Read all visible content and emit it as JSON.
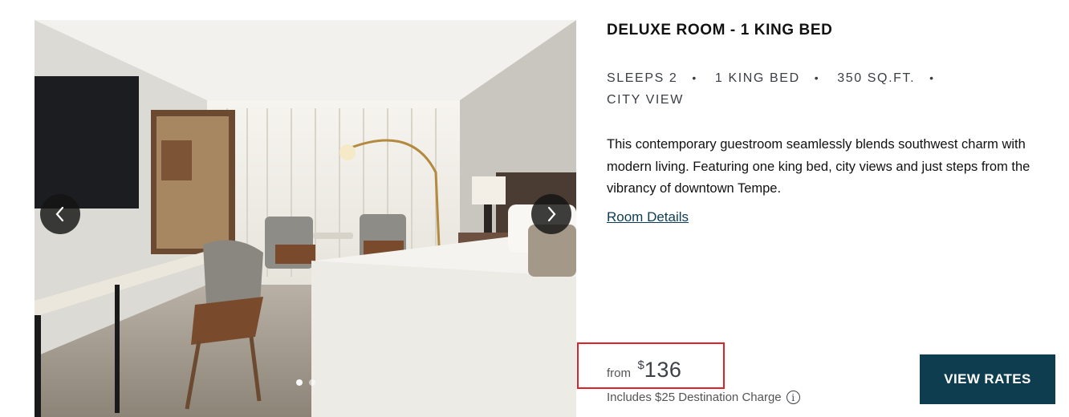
{
  "carousel": {
    "image_alt": "Deluxe room with king bed, desk, armchairs and city view",
    "prev_icon": "chevron-left-icon",
    "next_icon": "chevron-right-icon",
    "slide_count": 2,
    "active_slide": 1
  },
  "room": {
    "title": "DELUXE ROOM - 1 KING BED",
    "features": [
      "SLEEPS 2",
      "1 KING BED",
      "350 SQ.FT.",
      "CITY VIEW"
    ],
    "separator": "•",
    "description": "This contemporary guestroom seamlessly blends southwest charm with modern living. Featuring one king bed, city views and just steps from the vibrancy of downtown Tempe.",
    "details_link": "Room Details"
  },
  "pricing": {
    "from_label": "from",
    "currency": "$",
    "amount": "136",
    "fee_note": "Includes $25 Destination Charge",
    "info_icon": "i"
  },
  "cta": {
    "view_rates": "VIEW RATES"
  },
  "colors": {
    "button_bg": "#0d3d4e",
    "link": "#0e3c55",
    "highlight_border": "#e0202b"
  }
}
